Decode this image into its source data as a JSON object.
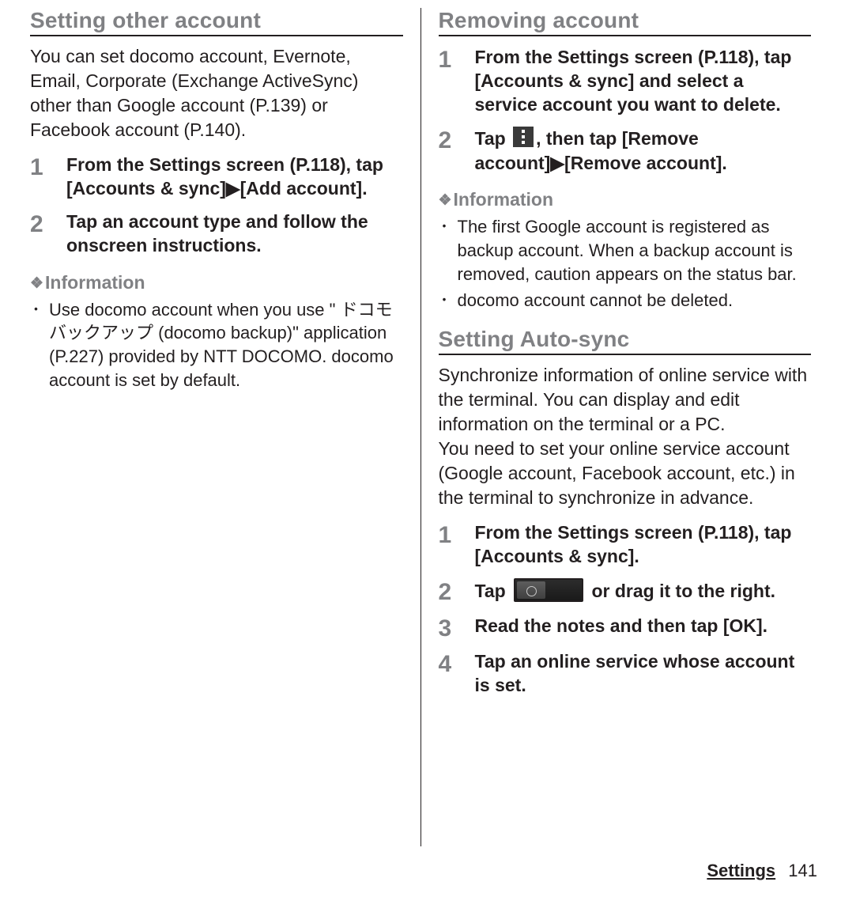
{
  "left": {
    "title": "Setting other account",
    "intro": "You can set docomo account, Evernote, Email, Corporate (Exchange ActiveSync) other than Google account (P.139) or Facebook account (P.140).",
    "steps": [
      {
        "num": "1",
        "text": "From the Settings screen (P.118), tap [Accounts & sync]▶[Add account]."
      },
      {
        "num": "2",
        "text": "Tap an account type and follow the onscreen instructions."
      }
    ],
    "info_heading": "Information",
    "info_items": [
      "Use docomo account when you use \" ドコモバックアップ (docomo backup)\" application (P.227) provided by NTT DOCOMO. docomo account is set by default."
    ]
  },
  "right": {
    "section1": {
      "title": "Removing account",
      "steps": [
        {
          "num": "1",
          "text": "From the Settings screen (P.118), tap [Accounts & sync] and select a service account you want to delete."
        },
        {
          "num": "2",
          "pre": "Tap ",
          "post": ", then tap [Remove account]▶[Remove account]."
        }
      ],
      "info_heading": "Information",
      "info_items": [
        "The first Google account is registered as backup account. When a backup account is removed, caution appears on the status bar.",
        "docomo account cannot be deleted."
      ]
    },
    "section2": {
      "title": "Setting Auto-sync",
      "intro": "Synchronize information of online service with the terminal. You can display and edit information on the terminal or a PC.\nYou need to set your online service account (Google account, Facebook account, etc.) in the terminal to synchronize in advance.",
      "steps": [
        {
          "num": "1",
          "text": "From the Settings screen (P.118), tap [Accounts & sync]."
        },
        {
          "num": "2",
          "pre": "Tap ",
          "post": " or drag it to the right."
        },
        {
          "num": "3",
          "text": "Read the notes and then tap [OK]."
        },
        {
          "num": "4",
          "text": "Tap an online service whose account is set."
        }
      ]
    }
  },
  "footer": {
    "label": "Settings",
    "page": "141"
  }
}
